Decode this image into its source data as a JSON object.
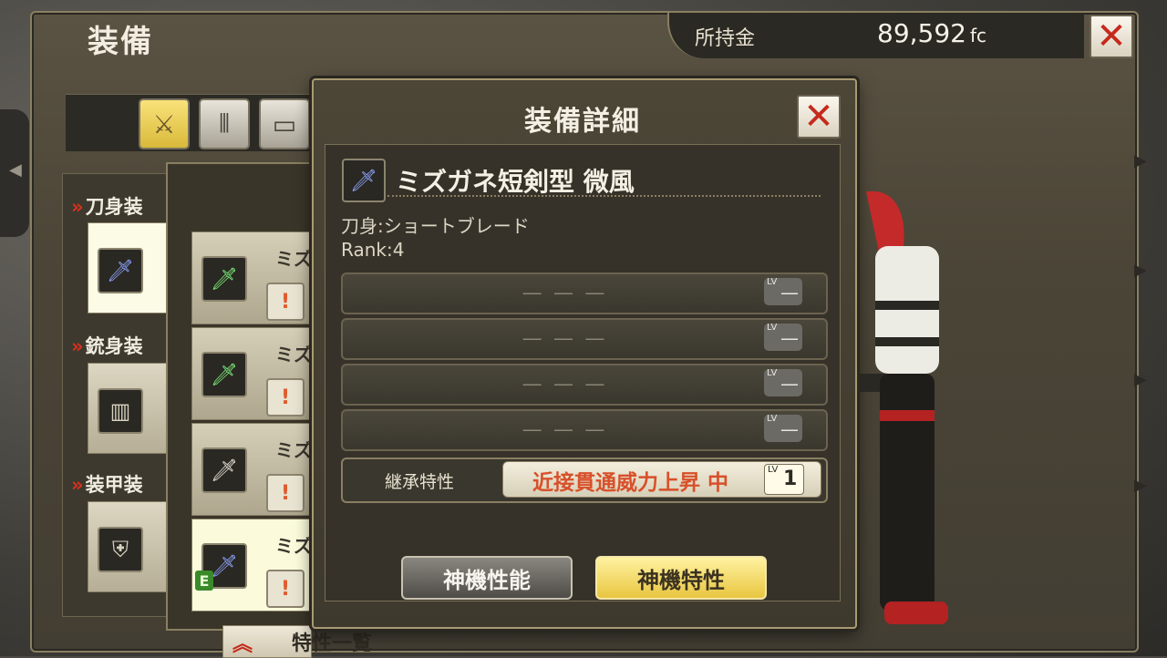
{
  "header": {
    "title": "装備",
    "money_label": "所持金",
    "money_value": "89,592",
    "money_unit": "fc"
  },
  "tabs": [
    {
      "icon": "blade-icon",
      "active": true
    },
    {
      "icon": "bullets-icon",
      "active": false
    },
    {
      "icon": "armor-icon",
      "active": false
    }
  ],
  "categories": {
    "blade": "刀身装",
    "gun": "銃身装",
    "armor": "装甲装"
  },
  "list": {
    "item_prefix": "ミズ",
    "items": [
      {
        "name": "ミズ",
        "selected": false
      },
      {
        "name": "ミズ",
        "selected": false
      },
      {
        "name": "ミズ",
        "selected": false
      },
      {
        "name": "ミズ",
        "selected": true
      }
    ],
    "equipped_badge": "E",
    "bottom_tab_label": "特性一覧"
  },
  "modal": {
    "title": "装備詳細",
    "item_name": "ミズガネ短剣型 微風",
    "type_line": "刀身:ショートブレード",
    "rank_line": "Rank:4",
    "traits": [
      {
        "name": "― ― ―",
        "lv_label": "LV",
        "lv": "—"
      },
      {
        "name": "― ― ―",
        "lv_label": "LV",
        "lv": "—"
      },
      {
        "name": "― ― ―",
        "lv_label": "LV",
        "lv": "—"
      },
      {
        "name": "― ― ―",
        "lv_label": "LV",
        "lv": "—"
      }
    ],
    "inherit_label": "継承特性",
    "inherit_value": "近接貫通威力上昇 中",
    "inherit_lv_label": "LV",
    "inherit_lv": "1",
    "button_performance": "神機性能",
    "button_traits": "神機特性"
  },
  "colors": {
    "accent_gold": "#e8c640",
    "close_red": "#c42a1c",
    "inherit_text": "#d8502a"
  }
}
